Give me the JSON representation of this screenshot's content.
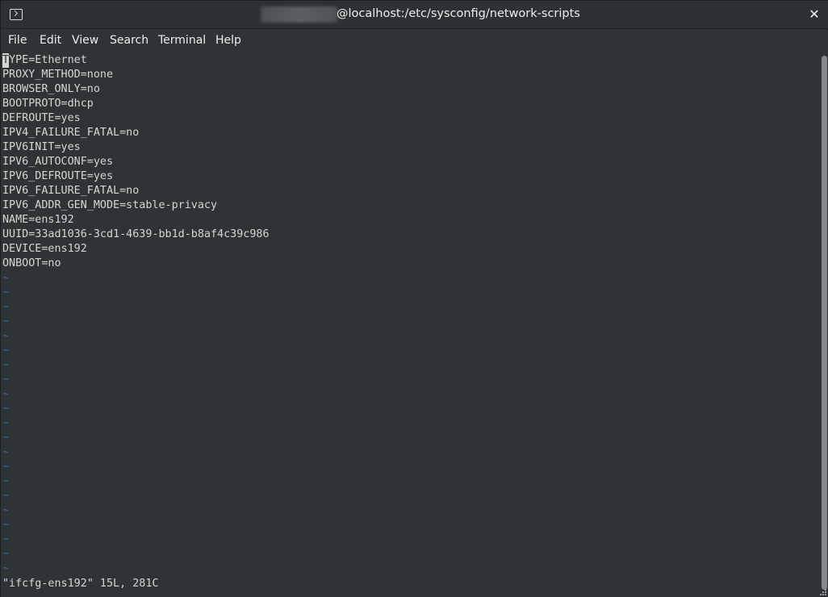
{
  "window": {
    "title": "@localhost:/etc/sysconfig/network-scripts",
    "close_icon": "close-icon",
    "terminal_icon": "terminal-icon"
  },
  "menu": [
    "File",
    "Edit",
    "View",
    "Search",
    "Terminal",
    "Help"
  ],
  "file_lines": [
    "TYPE=Ethernet",
    "PROXY_METHOD=none",
    "BROWSER_ONLY=no",
    "BOOTPROTO=dhcp",
    "DEFROUTE=yes",
    "IPV4_FAILURE_FATAL=no",
    "IPV6INIT=yes",
    "IPV6_AUTOCONF=yes",
    "IPV6_DEFROUTE=yes",
    "IPV6_FAILURE_FATAL=no",
    "IPV6_ADDR_GEN_MODE=stable-privacy",
    "NAME=ens192",
    "UUID=33ad1036-3cd1-4639-bb1d-b8af4c39c986",
    "DEVICE=ens192",
    "ONBOOT=no"
  ],
  "empty_line_marker": "~",
  "status_line": "\"ifcfg-ens192\" 15L, 281C",
  "colors": {
    "background": "#2e3436",
    "text": "#d3d7cf",
    "tilde": "#3465a4"
  }
}
